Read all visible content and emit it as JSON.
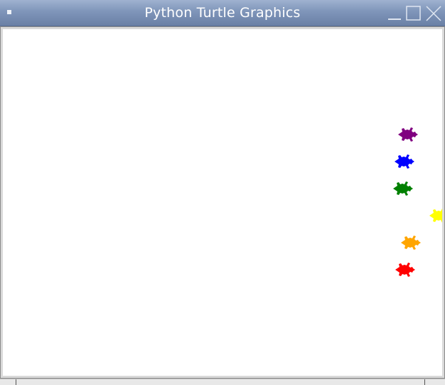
{
  "window": {
    "title": "Python Turtle Graphics"
  },
  "icons": {
    "menu": "window-menu-icon",
    "minimize": "minimize-icon",
    "maximize": "maximize-icon",
    "close": "close-icon",
    "turtle": "turtle-icon"
  },
  "canvas": {
    "background": "#ffffff"
  },
  "turtles": [
    {
      "color": "purple",
      "hex": "#800080"
    },
    {
      "color": "blue",
      "hex": "#0000ff"
    },
    {
      "color": "green",
      "hex": "#008000"
    },
    {
      "color": "yellow",
      "hex": "#ffff00"
    },
    {
      "color": "orange",
      "hex": "#ffa500"
    },
    {
      "color": "red",
      "hex": "#ff0000"
    }
  ]
}
